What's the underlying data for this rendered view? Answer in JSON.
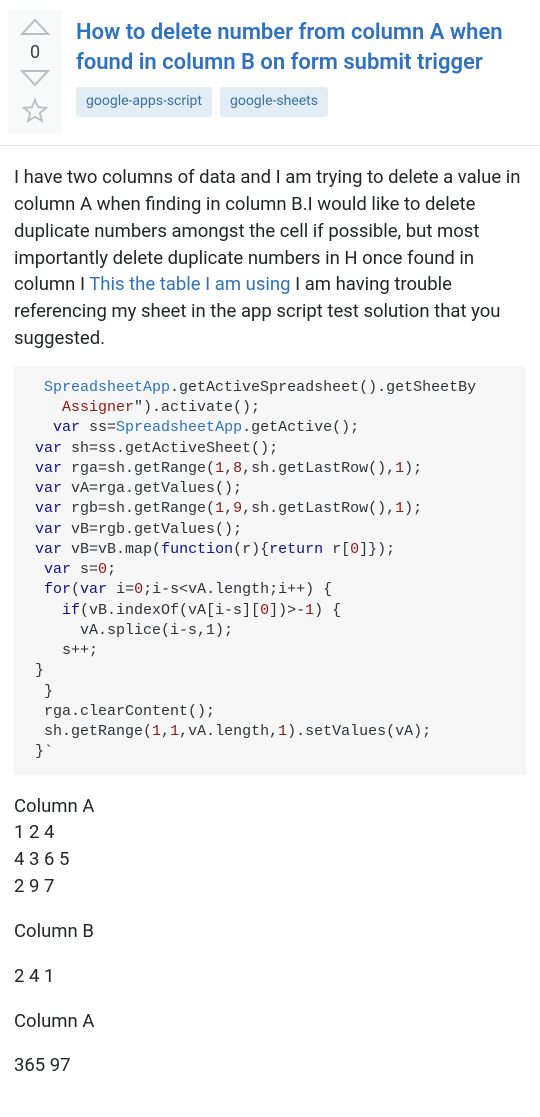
{
  "vote": {
    "score": "0"
  },
  "question": {
    "title": "How to delete number from column A when found in column B on form submit trigger",
    "tags": [
      "google-apps-script",
      "google-sheets"
    ],
    "body_pre": "I have two columns of data and I am trying to delete a value in column A when finding in column B.I would like to delete duplicate numbers amongst the cell if possible, but most importantly delete duplicate numbers in H once found in column I ",
    "body_link": "This the table I am using",
    "body_post": " I am having trouble referencing my sheet in the app script test solution that you suggested."
  },
  "code": {
    "l01a": "  ",
    "l01b": "SpreadsheetApp",
    "l01c": ".getActiveSpreadsheet().getSheetBy",
    "l02a": "    Assigner",
    "l02b": "\").activate();",
    "l03a": "   ",
    "l03b": "var",
    "l03c": " ss=",
    "l03d": "SpreadsheetApp",
    "l03e": ".getActive();",
    "l04a": " ",
    "l04b": "var",
    "l04c": " sh=ss.getActiveSheet();",
    "l05a": " ",
    "l05b": "var",
    "l05c": " rga=sh.getRange(",
    "l05d": "1",
    "l05e": ",",
    "l05f": "8",
    "l05g": ",sh.getLastRow(),",
    "l05h": "1",
    "l05i": ");",
    "l06a": " ",
    "l06b": "var",
    "l06c": " vA=rga.getValues();",
    "l07a": " ",
    "l07b": "var",
    "l07c": " rgb=sh.getRange(",
    "l07d": "1",
    "l07e": ",",
    "l07f": "9",
    "l07g": ",sh.getLastRow(),",
    "l07h": "1",
    "l07i": ");",
    "l08a": " ",
    "l08b": "var",
    "l08c": " vB=rgb.getValues();",
    "l09a": " ",
    "l09b": "var",
    "l09c": " vB=vB.map(",
    "l09d": "function",
    "l09e": "(r){",
    "l09f": "return",
    "l09g": " r[",
    "l09h": "0",
    "l09i": "]});",
    "l10a": "  ",
    "l10b": "var",
    "l10c": " s=",
    "l10d": "0",
    "l10e": ";",
    "l11a": "  ",
    "l11b": "for",
    "l11c": "(",
    "l11d": "var",
    "l11e": " i=",
    "l11f": "0",
    "l11g": ";i-s<vA.length;i++) {",
    "l12a": "    ",
    "l12b": "if",
    "l12c": "(vB.indexOf(vA[i-s][",
    "l12d": "0",
    "l12e": "])>-",
    "l12f": "1",
    "l12g": ") {",
    "l13": "      vA.splice(i-s,1);",
    "l14": "    s++;",
    "l15": " }",
    "l16": "  }",
    "l17": "  rga.clearContent();",
    "l18a": "  sh.getRange(",
    "l18b": "1",
    "l18c": ",",
    "l18d": "1",
    "l18e": ",vA.length,",
    "l18f": "1",
    "l18g": ").setValues(vA);",
    "l19": " }`"
  },
  "sample": {
    "h1": "Column A",
    "a1": "1 2 4",
    "a2": "4 3 6 5",
    "a3": "2 9 7",
    "h2": "Column B",
    "b1": "2 4 1",
    "h3": "Column A",
    "c1": "365 97"
  }
}
